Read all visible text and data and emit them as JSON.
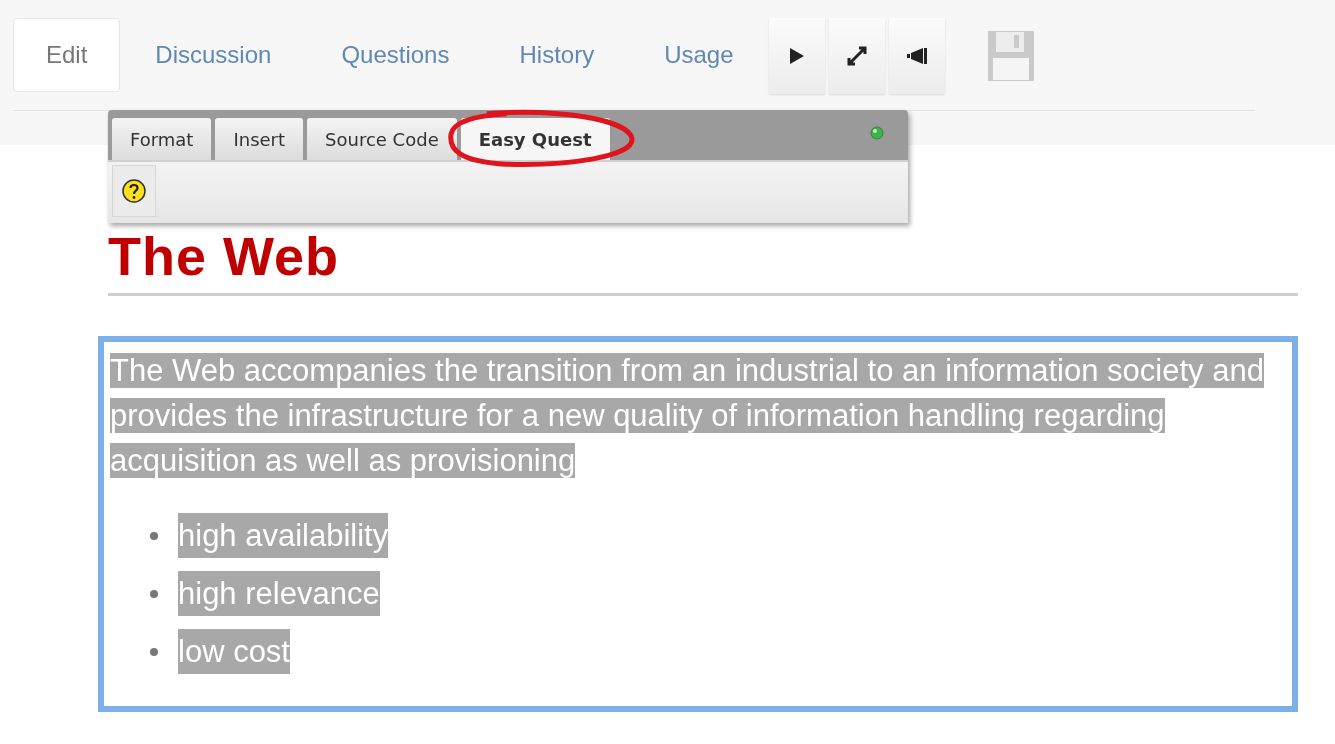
{
  "tabs": [
    {
      "label": "Edit",
      "selected": true
    },
    {
      "label": "Discussion",
      "selected": false
    },
    {
      "label": "Questions",
      "selected": false
    },
    {
      "label": "History",
      "selected": false
    },
    {
      "label": "Usage",
      "selected": false
    }
  ],
  "save_button": {
    "disabled": true
  },
  "editor_toolbar": {
    "tabs": [
      {
        "label": "Format",
        "selected": false
      },
      {
        "label": "Insert",
        "selected": false
      },
      {
        "label": "Source Code",
        "selected": false
      },
      {
        "label": "Easy Quest",
        "selected": true
      }
    ]
  },
  "content": {
    "heading": "The Web",
    "selected": true,
    "paragraph": "The Web accompanies the transition from an industrial to an information society and provides the infrastructure for a new quality of information handling regarding acquisition as well as provisioning",
    "bullets": [
      "high availability",
      "high relevance",
      "low cost"
    ]
  }
}
